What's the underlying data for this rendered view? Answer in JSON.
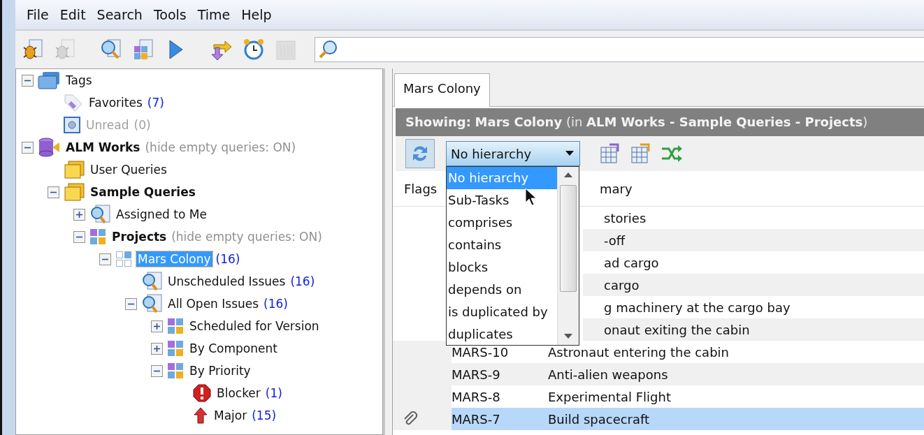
{
  "menu": [
    "File",
    "Edit",
    "Search",
    "Tools",
    "Time",
    "Help"
  ],
  "toolbar": [
    {
      "kind": "bug",
      "disabled": false
    },
    {
      "kind": "bug",
      "disabled": true
    },
    {
      "kind": "gap"
    },
    {
      "kind": "query",
      "disabled": false
    },
    {
      "kind": "grid",
      "disabled": false
    },
    {
      "kind": "play",
      "disabled": false
    },
    {
      "kind": "gap"
    },
    {
      "kind": "arrows",
      "disabled": false
    },
    {
      "kind": "clock",
      "disabled": false
    },
    {
      "kind": "panel",
      "disabled": true
    }
  ],
  "tree": [
    {
      "label": "Tags",
      "kind": "tags",
      "bold": false,
      "dimmed": false,
      "selected": false,
      "expanded": true,
      "children": [
        {
          "label": "Favorites",
          "count": "(7)",
          "kind": "tag",
          "bold": false,
          "dimmed": false,
          "selected": false
        },
        {
          "label": "Unread",
          "count": "(0)",
          "kind": "unread",
          "bold": false,
          "dimmed": true,
          "selected": false
        }
      ]
    },
    {
      "label": "ALM Works",
      "note": "(hide empty queries: ON)",
      "kind": "database",
      "bold": true,
      "dimmed": false,
      "selected": false,
      "expanded": true,
      "children": [
        {
          "label": "User Queries",
          "kind": "folder",
          "bold": false,
          "dimmed": false,
          "selected": false
        },
        {
          "label": "Sample Queries",
          "kind": "folder",
          "bold": true,
          "dimmed": false,
          "selected": false,
          "expanded": true,
          "children": [
            {
              "label": "Assigned to Me",
              "kind": "query",
              "bold": false,
              "dimmed": false,
              "selected": false,
              "expanded": false
            },
            {
              "label": "Projects",
              "note": "(hide empty queries: ON)",
              "kind": "grid",
              "bold": true,
              "dimmed": false,
              "selected": false,
              "expanded": true,
              "children": [
                {
                  "label": "Mars Colony",
                  "count": "(16)",
                  "kind": "grid-outline",
                  "bold": false,
                  "dimmed": false,
                  "selected": true,
                  "expanded": true,
                  "children": [
                    {
                      "label": "Unscheduled Issues",
                      "count": "(16)",
                      "kind": "query",
                      "bold": false,
                      "dimmed": false,
                      "selected": false
                    },
                    {
                      "label": "All Open Issues",
                      "count": "(16)",
                      "kind": "query",
                      "bold": false,
                      "dimmed": false,
                      "selected": false,
                      "expanded": true,
                      "children": [
                        {
                          "label": "Scheduled for Version",
                          "kind": "grid",
                          "bold": false,
                          "dimmed": false,
                          "selected": false,
                          "expanded": false
                        },
                        {
                          "label": "By Component",
                          "kind": "grid",
                          "bold": false,
                          "dimmed": false,
                          "selected": false,
                          "expanded": false
                        },
                        {
                          "label": "By Priority",
                          "kind": "grid",
                          "bold": false,
                          "dimmed": false,
                          "selected": false,
                          "expanded": true,
                          "children": [
                            {
                              "label": "Blocker",
                              "count": "(1)",
                              "kind": "blocker",
                              "bold": false,
                              "dimmed": false,
                              "selected": false
                            },
                            {
                              "label": "Major",
                              "count": "(15)",
                              "kind": "major",
                              "bold": false,
                              "dimmed": false,
                              "selected": false
                            }
                          ]
                        }
                      ]
                    }
                  ]
                }
              ]
            }
          ]
        }
      ]
    }
  ],
  "tabs": [
    {
      "label": "Mars Colony",
      "selected": true
    }
  ],
  "showing": "**Showing:** **Mars Colony** (in **ALM Works - Sample Queries - Projects**)",
  "hierarchy": {
    "value": "No hierarchy",
    "expanded": true,
    "options": [
      {
        "label": "No hierarchy",
        "selected": true
      },
      {
        "label": "Sub-Tasks",
        "selected": false
      },
      {
        "label": "comprises",
        "selected": false
      },
      {
        "label": "contains",
        "selected": false
      },
      {
        "label": "blocks",
        "selected": false
      },
      {
        "label": "depends on",
        "selected": false
      },
      {
        "label": "is duplicated by",
        "selected": false
      },
      {
        "label": "duplicates",
        "selected": false
      }
    ]
  },
  "columns": [
    {
      "kind": "flags",
      "label": "Flags"
    },
    {
      "kind": "key"
    },
    {
      "kind": "summary",
      "label": "mary"
    }
  ],
  "rows": [
    {
      "summary": "stories",
      "selected": false
    },
    {
      "summary": "-off",
      "selected": false
    },
    {
      "summary": "ad cargo",
      "selected": false
    },
    {
      "summary": "cargo",
      "selected": false
    },
    {
      "summary": "g machinery at the cargo bay",
      "selected": false
    },
    {
      "summary": "onaut exiting the cabin",
      "selected": false
    },
    {
      "key": "MARS-10",
      "summary": "Astronaut entering the cabin",
      "attachment": false,
      "selected": false
    },
    {
      "key": "MARS-9",
      "summary": "Anti-alien weapons",
      "attachment": false,
      "selected": false
    },
    {
      "key": "MARS-8",
      "summary": "Experimental Flight",
      "attachment": false,
      "selected": false
    },
    {
      "key": "MARS-7",
      "summary": "Build spacecraft",
      "attachment": true,
      "selected": true
    }
  ]
}
